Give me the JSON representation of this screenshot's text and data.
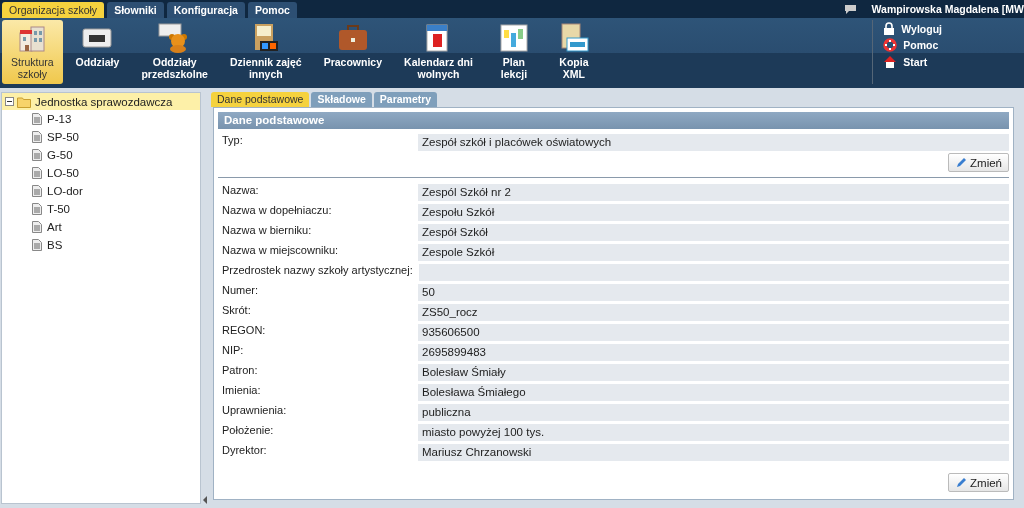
{
  "menu_tabs": [
    {
      "label": "Organizacja szkoły",
      "selected": true
    },
    {
      "label": "Słowniki",
      "selected": false
    },
    {
      "label": "Konfiguracja",
      "selected": false
    },
    {
      "label": "Pomoc",
      "selected": false
    }
  ],
  "user": "Wampirowska Magdalena [MW",
  "toolbar": [
    {
      "kind": "building",
      "label": "Struktura szkoły",
      "selected": true
    },
    {
      "kind": "class",
      "label": "Oddziały",
      "selected": false
    },
    {
      "kind": "bear",
      "label": "Oddziały przedszkolne",
      "selected": false
    },
    {
      "kind": "journal",
      "label": "Dziennik zajęć innych",
      "selected": false
    },
    {
      "kind": "briefcase",
      "label": "Pracownicy",
      "selected": false
    },
    {
      "kind": "calendar",
      "label": "Kalendarz dni wolnych",
      "selected": false
    },
    {
      "kind": "plan",
      "label": "Plan lekcji",
      "selected": false
    },
    {
      "kind": "xml",
      "label": "Kopia XML",
      "selected": false
    }
  ],
  "side_links": [
    {
      "kind": "lock",
      "label": "Wyloguj"
    },
    {
      "kind": "lifebuoy",
      "label": "Pomoc"
    },
    {
      "kind": "home",
      "label": "Start"
    }
  ],
  "tree": {
    "label": "Jednostka sprawozdawcza",
    "expanded": true,
    "selected": true,
    "children": [
      {
        "label": "P-13"
      },
      {
        "label": "SP-50"
      },
      {
        "label": "G-50"
      },
      {
        "label": "LO-50"
      },
      {
        "label": "LO-dor"
      },
      {
        "label": "T-50"
      },
      {
        "label": "Art"
      },
      {
        "label": "BS"
      }
    ]
  },
  "content_tabs": [
    {
      "label": "Dane podstawowe",
      "selected": true
    },
    {
      "label": "Składowe",
      "selected": false
    },
    {
      "label": "Parametry",
      "selected": false
    }
  ],
  "panel_title": "Dane podstawowe",
  "type_section": {
    "fields": [
      {
        "label": "Typ:",
        "value": "Zespół szkół i placówek oświatowych"
      }
    ],
    "button": "Zmień"
  },
  "details_section": {
    "fields": [
      {
        "label": "Nazwa:",
        "value": "Zespól Szkół nr 2"
      },
      {
        "label": "Nazwa w dopełniaczu:",
        "value": "Zespołu Szkół"
      },
      {
        "label": "Nazwa w bierniku:",
        "value": "Zespół Szkół"
      },
      {
        "label": "Nazwa w miejscowniku:",
        "value": "Zespole Szkół"
      },
      {
        "label": "Przedrostek nazwy szkoły artystycznej:"
      },
      {
        "label": "Numer:",
        "value": "50"
      },
      {
        "label": "Skrót:",
        "value": "ZS50_rocz"
      },
      {
        "label": "REGON:",
        "value": "935606500"
      },
      {
        "label": "NIP:",
        "value": "2695899483"
      },
      {
        "label": "Patron:",
        "value": "Bolesław Śmiały"
      },
      {
        "label": "Imienia:",
        "value": "Bolesława Śmiałego"
      },
      {
        "label": "Uprawnienia:",
        "value": "publiczna"
      },
      {
        "label": "Położenie:",
        "value": "miasto powyżej 100 tys."
      },
      {
        "label": "Dyrektor:",
        "value": "Mariusz Chrzanowski"
      }
    ],
    "button": "Zmień"
  }
}
